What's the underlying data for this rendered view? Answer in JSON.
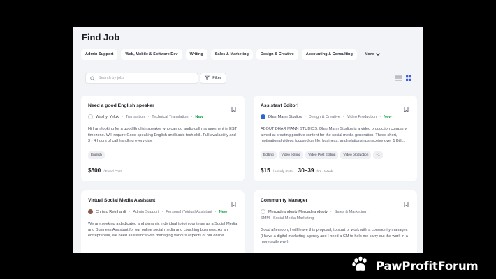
{
  "page": {
    "title": "Find Job"
  },
  "categories": [
    "Admin Support",
    "Web, Mobile & Software Dev",
    "Writing",
    "Sales & Marketing",
    "Design & Creative",
    "Accounting & Consulting"
  ],
  "more_label": "More",
  "search": {
    "placeholder": "Search by jobs",
    "value": ""
  },
  "filter_label": "Filter",
  "view": {
    "active": "grid"
  },
  "jobs": [
    {
      "title": "Need a good English speaker",
      "poster": "Washyl Yeluk",
      "category": "Translation",
      "subcategory": "Technical Translation",
      "badge": "New",
      "description": "Hi I am looking for a good English speaker who can do audio call management in EST timezone. Will require Good speaking English and basic tech skill. Full availability and 3 - 4 hours of call handling every day.",
      "tags": [
        "English"
      ],
      "price": "$500",
      "price_unit": "/ Fixed Cost"
    },
    {
      "title": "Assistant Editor!",
      "poster": "Dhar Mann Studios",
      "category": "Design & Creative",
      "subcategory": "Video Production",
      "badge": "New",
      "description": "ABOUT DHAR MANN STUDIOS: Dhar Mann Studios is a video production company aimed at creating positive content for the social media generation. These short, motivational videos focused on life, business, and relationships receive over 1 Billi...",
      "tags": [
        "Editing",
        "Video editing",
        "Video Post Editing",
        "Video production",
        "+1"
      ],
      "price": "$15",
      "price_unit": "/ Hourly Rate",
      "hours": "30–39",
      "hours_unit": "hrs / Week"
    },
    {
      "title": "Virtual Social Media Assistant",
      "poster": "Christo Reinhardt",
      "category": "Admin Support",
      "subcategory": "Personal / Virtual Assistant",
      "badge": "New",
      "description": "We are seeking a dedicated and dynamic individual to join our team as a Social Media and Business Assistant for our online social media and coaching business. As an entrepreneur, we need assistance with managing various aspects of our online..."
    },
    {
      "title": "Community Manager",
      "poster": "Mercadeandopty Mercadeandopty",
      "category": "Sales & Marketing",
      "subcategory": "SMM - Social Media Marketing",
      "description": "Good afternoon, I will leave this proposal, to start or work with a community manager. (I have a digital marketing agency and I need a CM to help me carry out the work in a more agile way)."
    }
  ],
  "watermark": {
    "text": "PawProfitForum"
  },
  "colors": {
    "new_badge": "#17a34a",
    "grid_active": "#3b5bdb",
    "background": "#f3f4f7"
  }
}
